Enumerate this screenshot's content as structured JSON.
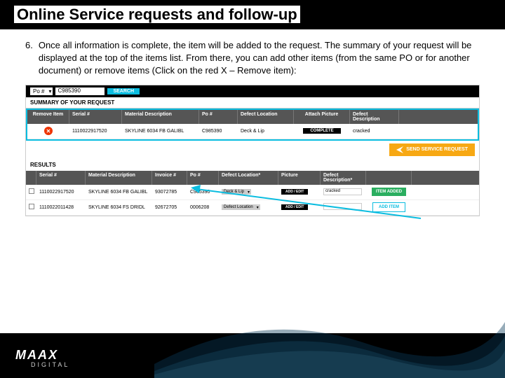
{
  "title": "Online Service requests and follow-up",
  "step_num": "6.",
  "step_text": "Once all information is complete, the item will be added to the request. The summary of your request will be displayed at the top of the items list. From there, you can add other items (from the same PO or for another document) or remove items (Click on the red X – Remove item):",
  "search": {
    "dropdown": "Po #",
    "value": "C985390",
    "btn": "SEARCH"
  },
  "summary_label": "SUMMARY OF YOUR REQUEST",
  "summary_cols": {
    "remove": "Remove Item",
    "serial": "Serial #",
    "mat": "Material Description",
    "po": "Po #",
    "loc": "Defect Location",
    "pic": "Attach Picture",
    "desc": "Defect Description"
  },
  "summary_row": {
    "serial": "1110022917520",
    "mat": "SKYLINE 6034 FB GALIBL",
    "po": "C985390",
    "loc": "Deck & Lip",
    "pic": "COMPLETE",
    "desc": "cracked"
  },
  "send_btn": "SEND SERVICE REQUEST",
  "results_label": "RESULTS",
  "results_cols": {
    "serial": "Serial #",
    "mat": "Material Description",
    "inv": "Invoice #",
    "po": "Po #",
    "loc": "Defect Location*",
    "pic": "Picture",
    "desc": "Defect Description*"
  },
  "results_rows": [
    {
      "serial": "1110022917520",
      "mat": "SKYLINE 6034 FB GALIBL",
      "inv": "93072785",
      "po": "C985390",
      "loc": "Deck & Lip",
      "pic": "ADD / EDIT",
      "desc": "cracked",
      "action": "ITEM ADDED"
    },
    {
      "serial": "1110022011428",
      "mat": "SKYLINE 6034 FS DRIDL",
      "inv": "92672705",
      "po": "0006208",
      "loc": "Defect Location",
      "pic": "ADD / EDIT",
      "desc": "",
      "action": "ADD ITEM"
    }
  ],
  "logo": {
    "main": "MAAX",
    "sub": "DIGITAL"
  }
}
